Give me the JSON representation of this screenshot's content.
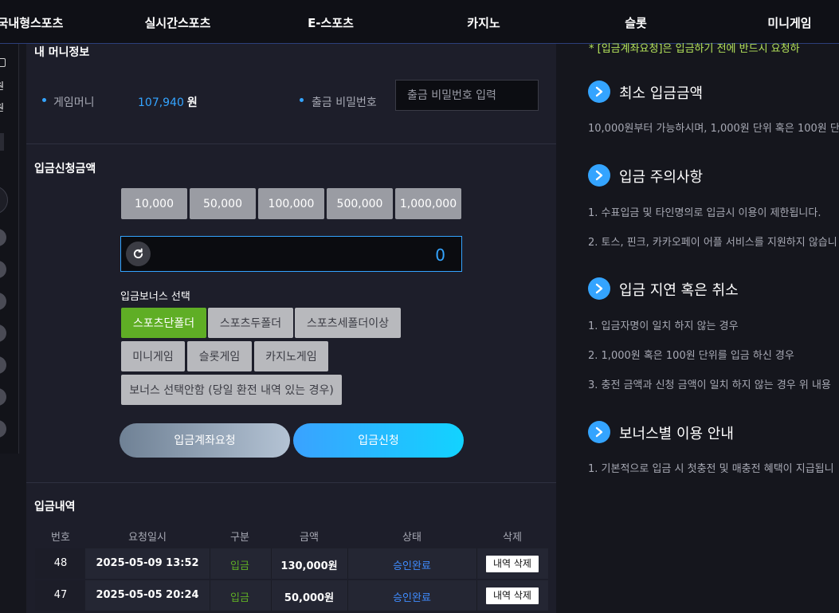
{
  "nav": {
    "items": [
      "국내형스포츠",
      "실시간스포츠",
      "E-스포츠",
      "카지노",
      "슬롯",
      "미니게임"
    ]
  },
  "sidebar": {
    "won_1": "원",
    "won_2": "원"
  },
  "money_info": {
    "title": "내 머니정보",
    "game_money_label": "게임머니",
    "game_money_value": "107,940",
    "game_money_unit": "원",
    "withdraw_pw_label": "출금 비밀번호",
    "withdraw_pw_placeholder": "출금 비밀번호 입력"
  },
  "deposit_request": {
    "title": "입금신청금액",
    "quick_amounts": [
      "10,000",
      "50,000",
      "100,000",
      "500,000",
      "1,000,000"
    ],
    "amount_value": "0",
    "bonus_label": "입금보너스 선택",
    "bonus_options": [
      {
        "label": "스포츠단폴더",
        "active": true
      },
      {
        "label": "스포츠두폴더",
        "active": false
      },
      {
        "label": "스포츠세폴더이상",
        "active": false
      },
      {
        "label": "미니게임",
        "active": false
      },
      {
        "label": "슬롯게임",
        "active": false
      },
      {
        "label": "카지노게임",
        "active": false
      },
      {
        "label": "보너스 선택안함 (당일 환전 내역 있는 경우)",
        "active": false
      }
    ],
    "account_request_label": "입금계좌요청",
    "submit_label": "입금신청"
  },
  "history": {
    "title": "입금내역",
    "columns": [
      "번호",
      "요청일시",
      "구분",
      "금액",
      "상태",
      "삭제"
    ],
    "rows": [
      {
        "no": "48",
        "date": "2025-05-09 13:52",
        "type": "입금",
        "amount": "130,000원",
        "status": "승인완료",
        "delete": "내역 삭제"
      },
      {
        "no": "47",
        "date": "2025-05-05 20:24",
        "type": "입금",
        "amount": "50,000원",
        "status": "승인완료",
        "delete": "내역 삭제"
      }
    ]
  },
  "guide": {
    "notice": "* [입금계좌요청]은 입금하기 전에 반드시 요청하",
    "sections": [
      {
        "title": "최소 입금금액",
        "lines": [
          "10,000원부터 가능하시며, 1,000원 단위 혹은 100원 단"
        ]
      },
      {
        "title": "입금 주의사항",
        "lines": [
          "1. 수표입금 및 타인명의로 입금시 이용이 제한됩니다.",
          "2. 토스, 핀크, 카카오페이 어플 서비스를 지원하지 않습니"
        ]
      },
      {
        "title": "입금 지연 혹은 취소",
        "lines": [
          "1. 입금자명이 일치 하지 않는 경우",
          "2. 1,000원 혹은 100원 단위를 입금 하신 경우",
          "3. 충전 금액과 신청 금액이 일치 하지 않는 경우 위 내용"
        ]
      },
      {
        "title": "보너스별 이용 안내",
        "lines": [
          "1. 기본적으로 입금 시 첫충전 및 매충전 혜택이 지급됩니"
        ]
      }
    ]
  },
  "colors": {
    "accent_blue": "#34a4ff",
    "active_green": "#5fae25",
    "notice_green": "#b4e35a",
    "deposit_green": "#5fae25",
    "status_blue": "#3f8cff"
  }
}
